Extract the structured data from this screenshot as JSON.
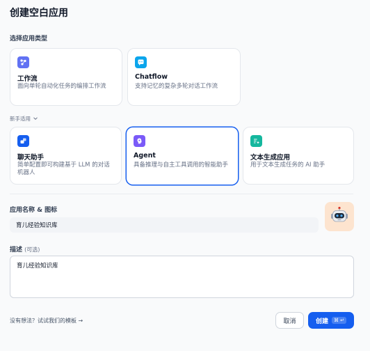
{
  "dialog": {
    "title": "创建空白应用"
  },
  "app_type": {
    "label": "选择应用类型",
    "beginner_label": "新手适用",
    "cards": [
      {
        "title": "工作流",
        "desc": "面向单轮自动化任务的编排工作流",
        "icon": "workflow-icon",
        "color": "#6172f3"
      },
      {
        "title": "Chatflow",
        "desc": "支持记忆的复杂多轮对话工作流",
        "icon": "chatflow-icon",
        "color": "#0ba5ec"
      },
      {
        "title": "聊天助手",
        "desc": "简单配置即可构建基于 LLM 的对话机器人",
        "icon": "chat-assistant-icon",
        "color": "#155eef"
      },
      {
        "title": "Agent",
        "desc": "具备推理与自主工具调用的智能助手",
        "icon": "agent-icon",
        "color": "#7a5af8"
      },
      {
        "title": "文本生成应用",
        "desc": "用于文本生成任务的 AI 助手",
        "icon": "text-generation-icon",
        "color": "#15b79e"
      }
    ]
  },
  "name_section": {
    "label": "应用名称 & 图标",
    "value": "育儿经验知识库"
  },
  "description": {
    "label": "描述",
    "optional": "(可选)",
    "value": "育儿经验知识库"
  },
  "footer": {
    "template_link": "没有想法？试试我们的模板 →",
    "cancel": "取消",
    "create": "创建",
    "create_shortcut": "⌘ ↵"
  },
  "colors": {
    "accent": "#155eef",
    "avatar_bg": "#fde4cf"
  }
}
